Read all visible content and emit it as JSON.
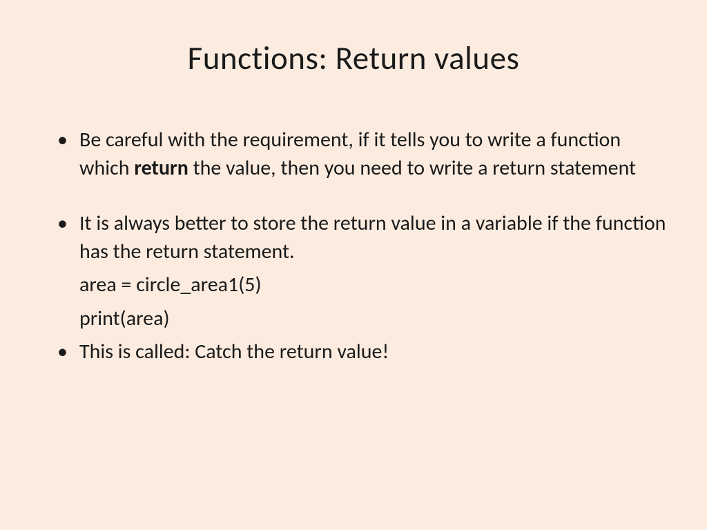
{
  "slide": {
    "title": "Functions: Return values",
    "bullets": {
      "b1_pre": "Be careful with the requirement, if it tells you to write a function which ",
      "b1_bold": "return",
      "b1_post": " the value, then you need to write a return statement",
      "b2": "It is always better to store the return value in a variable if the function has the return statement.",
      "code1": "area = circle_area1(5)",
      "code2": "print(area)",
      "b3": "This is called: Catch the return value!"
    }
  }
}
